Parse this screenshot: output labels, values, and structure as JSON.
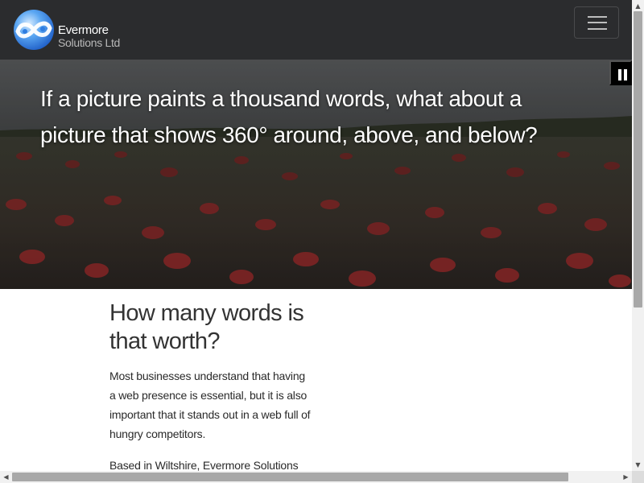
{
  "navbar": {
    "brand_line1": "Evermore",
    "brand_line2": "Solutions Ltd",
    "logo_icon": "evermore-infinity-logo",
    "toggler_icon": "hamburger-menu-icon"
  },
  "hero": {
    "heading": "If a picture paints a thousand words, what about a picture that shows 360° around, above, and below?",
    "pause_icon": "pause-icon"
  },
  "content": {
    "heading": "How many words is that worth?",
    "paragraphs": [
      "Most businesses understand that having a web presence is essential, but it is also important that it stands out in a web full of hungry competitors.",
      "Based in Wiltshire, Evermore Solutions"
    ]
  },
  "colors": {
    "navbar_bg": "#2b2c2e",
    "accent_blue": "#2f7de0",
    "text_dark": "#333333"
  }
}
